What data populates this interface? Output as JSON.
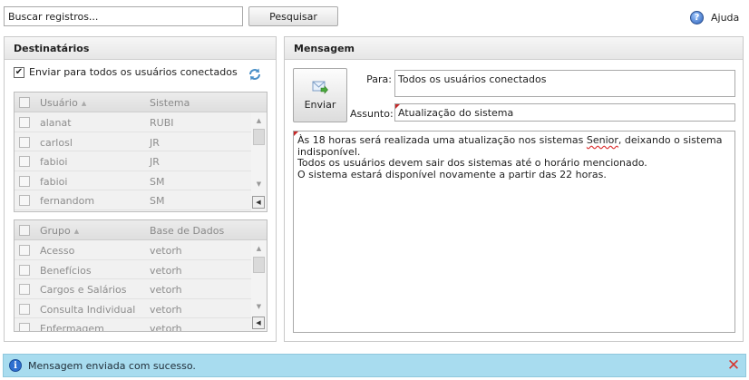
{
  "topbar": {
    "search_value": "Buscar registros...",
    "search_button": "Pesquisar",
    "help_label": "Ajuda"
  },
  "recipients": {
    "title": "Destinatários",
    "send_all_label": "Enviar para todos os usuários conectados",
    "send_all_checked": true,
    "users_grid": {
      "col_user": "Usuário",
      "col_system": "Sistema",
      "rows": [
        {
          "user": "alanat",
          "system": "RUBI"
        },
        {
          "user": "carlosl",
          "system": "JR"
        },
        {
          "user": "fabioi",
          "system": "JR"
        },
        {
          "user": "fabioi",
          "system": "SM"
        },
        {
          "user": "fernandom",
          "system": "SM"
        }
      ]
    },
    "groups_grid": {
      "col_group": "Grupo",
      "col_database": "Base de Dados",
      "rows": [
        {
          "group": "Acesso",
          "database": "vetorh"
        },
        {
          "group": "Benefícios",
          "database": "vetorh"
        },
        {
          "group": "Cargos e Salários",
          "database": "vetorh"
        },
        {
          "group": "Consulta Individual",
          "database": "vetorh"
        },
        {
          "group": "Enfermagem",
          "database": "vetorh"
        }
      ]
    }
  },
  "message": {
    "title": "Mensagem",
    "send_button": "Enviar",
    "to_label": "Para:",
    "to_value": "Todos os usuários conectados",
    "subject_label": "Assunto:",
    "subject_value": "Atualização do sistema",
    "body_line1_a": "Às 18 horas será realizada uma atualização nos sistemas ",
    "body_line1_word": "Senior",
    "body_line1_b": ", deixando o sistema indisponível.",
    "body_line2": "Todos os usuários devem sair dos sistemas até o horário mencionado.",
    "body_line3": "O sistema estará disponível novamente a partir das 22 horas."
  },
  "status": {
    "text": "Mensagem enviada com sucesso."
  },
  "colors": {
    "status_background": "#a8dcef",
    "close_icon": "#d6362f",
    "info_icon": "#2e6fd0"
  }
}
